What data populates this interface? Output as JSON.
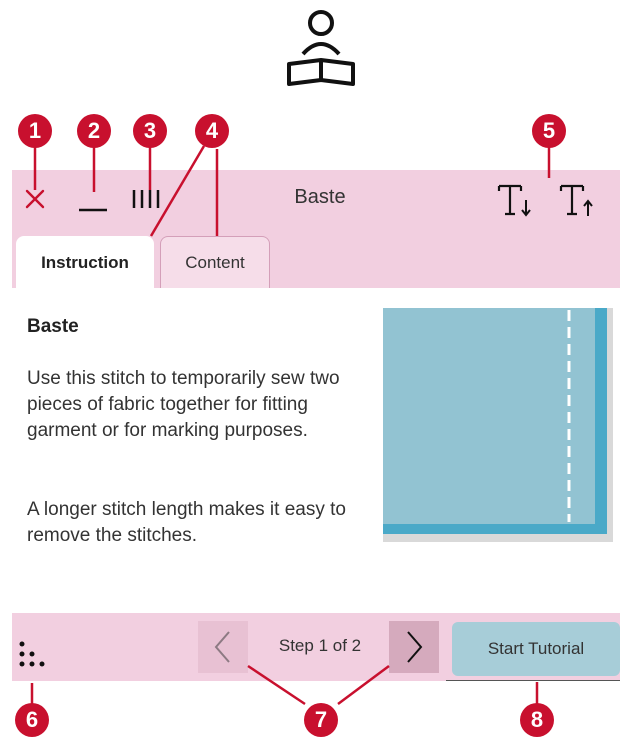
{
  "header": {
    "title": "Baste",
    "icons": {
      "close": "close-icon",
      "minimize": "minimize-icon",
      "stitch_lines": "stitch-lines-icon",
      "text_decrease": "text-size-decrease-icon",
      "text_increase": "text-size-increase-icon"
    }
  },
  "tabs": [
    {
      "label": "Instruction",
      "active": true
    },
    {
      "label": "Content",
      "active": false
    }
  ],
  "content": {
    "title": "Baste",
    "paragraphs": [
      "Use this stitch to temporarily sew two pieces of fabric together for fitting garment or for marking purposes.",
      "A longer stitch length makes it easy to remove the stitches."
    ]
  },
  "footer": {
    "step_label": "Step 1 of 2",
    "start_button": "Start Tutorial"
  },
  "callouts": [
    "1",
    "2",
    "3",
    "4",
    "5",
    "6",
    "7",
    "8"
  ],
  "colors": {
    "accent": "#c8102e",
    "bar": "#f2cfe0",
    "fabric": "#92c3d2",
    "start_button": "#a7cdd8"
  }
}
